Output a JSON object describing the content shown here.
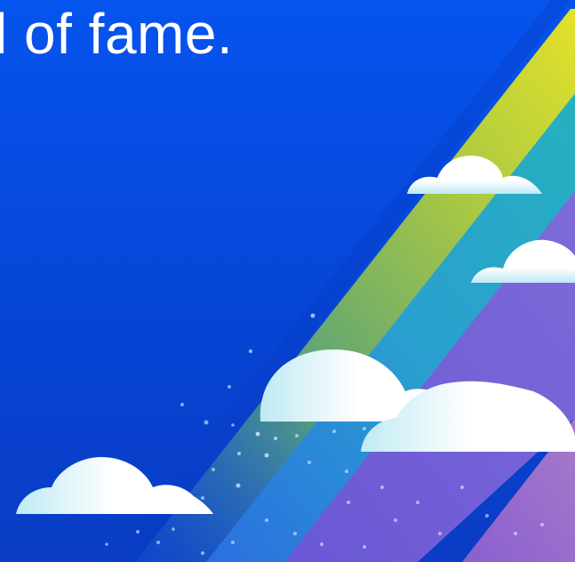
{
  "headline": "l of fame.",
  "colors": {
    "background": "#0654ee",
    "stripe_yellow": "#d7e029",
    "stripe_teal": "#27a6c4",
    "stripe_purple": "#7b63d3",
    "stripe_magenta": "#9a6fc9",
    "cloud": "#ffffff",
    "headline_text": "#ffffff"
  }
}
